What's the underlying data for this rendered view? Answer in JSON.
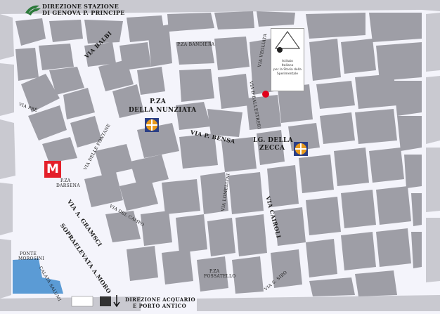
{
  "header": {
    "line1": "DIREZIONE STAZIONE",
    "line2": "DI GENOVA P. PRINCIPE"
  },
  "legend": {
    "line1": "DIREZIONE ACQUARIO",
    "line2": "E PORTO ANTICO"
  },
  "institute_box": {
    "line1": "Istituto",
    "line2": "Italiano",
    "line3": "per la Storia della",
    "line4": "Sperimentale"
  },
  "labels": {
    "via_balbi": "VIA BALBI",
    "p_za_bandiera": "P.ZA BANDIERA",
    "via_vegliata": "VIA VEGLIATA",
    "via_d_ballesti": "VIA D'BALLESTRERI",
    "p_za_nunziata_1": "P.ZA",
    "p_za_nunziata_2": "DELLA NUNZIATA",
    "via_p_bensa": "VIA P. BENSA",
    "lg_della_zecca_1": "LG. DELLA",
    "lg_della_zecca_2": "ZECCA",
    "via_delle_fontane": "VIA DELLE FONTANE",
    "p_za_darsena_1": "P.ZA",
    "p_za_darsena_2": "DARSENA",
    "via_a_gramsci": "VIA A. GRAMSCI",
    "sopraelevata": "SOPRAELEVATA A.MORO",
    "via_del_campo": "VIA DEL CAMPO",
    "via_lomellini": "VIA LOMELLINI",
    "via_cairoli": "VIA CAIROLI",
    "p_za_fossatello_1": "P.ZA",
    "p_za_fossatello_2": "FOSSATELLO",
    "via_s_siro": "VIA S. SIRO",
    "ponte_morosini_1": "PONTE",
    "ponte_morosini_2": "MOROSINI",
    "calata_salumi": "CALATA SALUMI",
    "via_prè": "VIA PRÈ",
    "metro_letter": "M"
  },
  "colors": {
    "street": "#f4f4fb",
    "block": "#9e9ea6",
    "water": "#5b9bd5",
    "marker": "#e0001b",
    "metro": "#e4202a",
    "frame": "#bcbcc4"
  },
  "icons": {
    "metro": "metro-icon",
    "museum": "museum-icon",
    "destination": "location-marker-icon"
  }
}
